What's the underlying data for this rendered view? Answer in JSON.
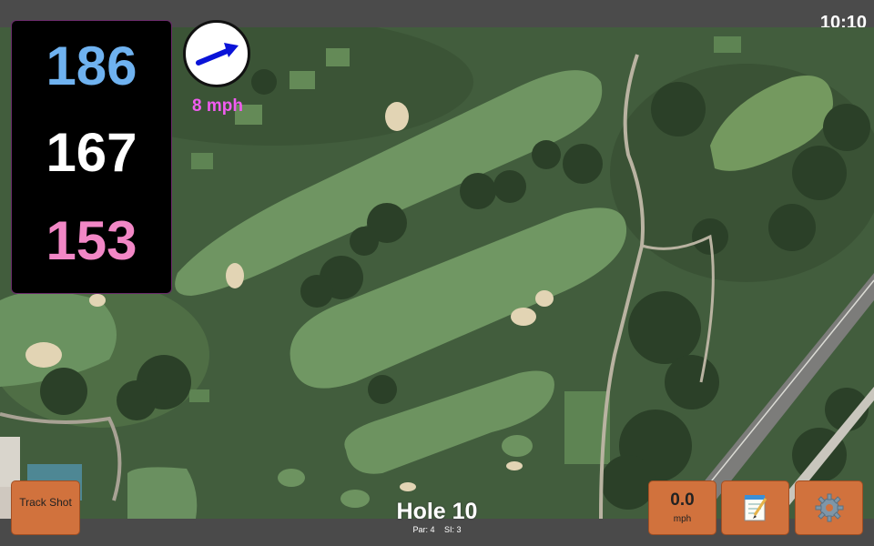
{
  "status_bar": {
    "time": "10:10"
  },
  "distances": {
    "back": "186",
    "center": "167",
    "front": "153"
  },
  "wind": {
    "speed": "8 mph",
    "direction_icon": "wind-arrow-icon"
  },
  "hole": {
    "title": "Hole 10",
    "par": "Par: 4",
    "si": "SI: 3"
  },
  "buttons": {
    "track_shot": "Track Shot",
    "speed_value": "0.0",
    "speed_unit": "mph",
    "notes_icon": "notepad-icon",
    "settings_icon": "gear-icon"
  },
  "colors": {
    "back": "#6fb2f0",
    "center": "#ffffff",
    "front": "#f287c6",
    "wind_text": "#f15cf0",
    "button": "#d1723d"
  }
}
